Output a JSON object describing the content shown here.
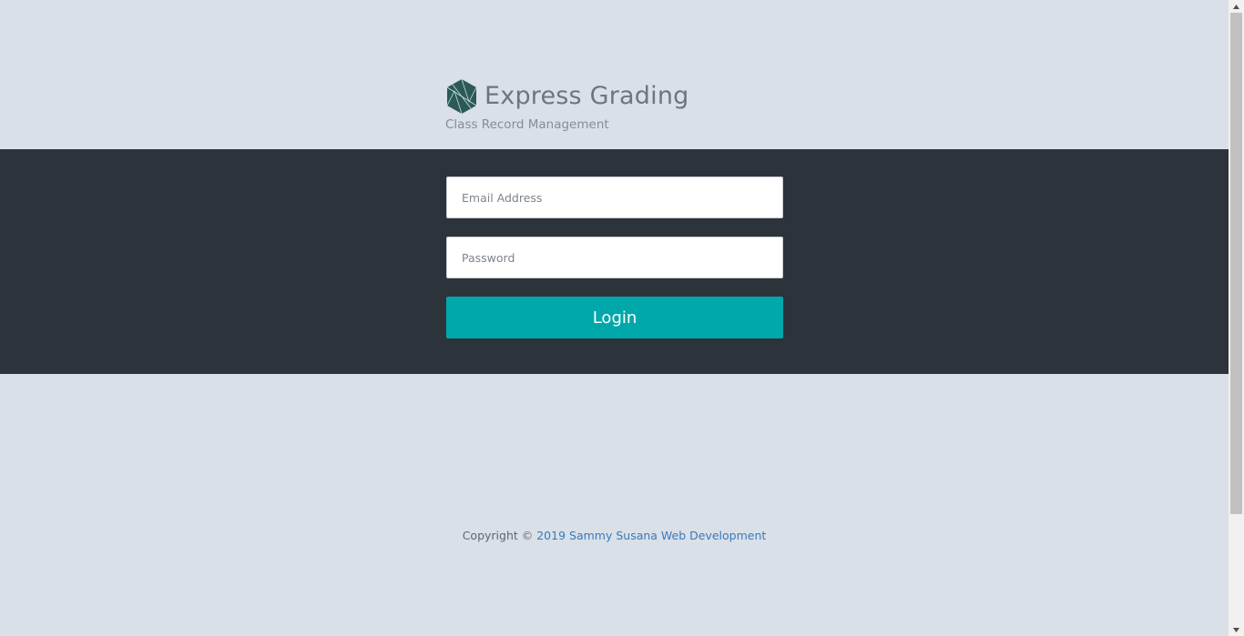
{
  "brand": {
    "title": "Express Grading",
    "subtitle": "Class Record Management",
    "logo_icon": "hexagon-logo-icon"
  },
  "form": {
    "email_placeholder": "Email Address",
    "email_value": "",
    "password_placeholder": "Password",
    "password_value": "",
    "login_label": "Login"
  },
  "footer": {
    "prefix": "Copyright ©",
    "link_text": "2019 Sammy Susana Web Development"
  },
  "colors": {
    "background": "#d9e0e8",
    "band": "#2d333b",
    "accent": "#00a8ab",
    "link": "#3a7ab8",
    "logo": "#2b5a55"
  }
}
